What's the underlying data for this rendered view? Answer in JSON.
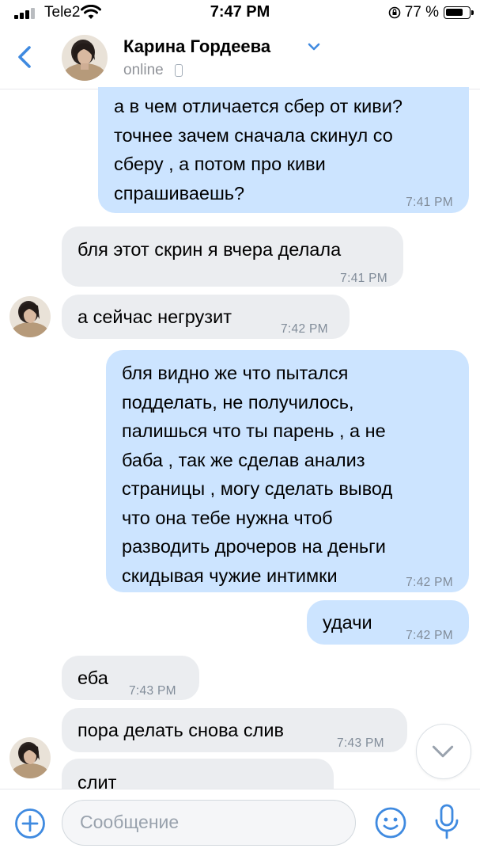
{
  "status_bar": {
    "carrier": "Tele2",
    "time": "7:47 PM",
    "battery": "77 %",
    "battery_level": 0.77
  },
  "header": {
    "contact_name": "Карина Гордеева",
    "status": "online"
  },
  "messages": [
    {
      "dir": "out",
      "text": "а в чем отличается сбер от киви?\nточнее зачем сначала скинул со\nсберу , а потом про киви\nспрашиваешь?",
      "time": "7:41 PM"
    },
    {
      "dir": "in",
      "text": "бля этот скрин я вчера делала",
      "time": "7:41 PM"
    },
    {
      "dir": "in",
      "text": "а сейчас негрузит",
      "time": "7:42 PM"
    },
    {
      "dir": "out",
      "text": "бля видно же что пытался\nподделать, не получилось,\nпалишься что ты парень , а не\nбаба , так же сделав анализ\nстраницы , могу сделать вывод\nчто она тебе нужна чтоб\nразводить дрочеров на деньги\nскидывая чужие интимки",
      "time": "7:42 PM"
    },
    {
      "dir": "out",
      "text": "удачи",
      "time": "7:42 PM"
    },
    {
      "dir": "in",
      "text": "еба",
      "time": "7:43 PM"
    },
    {
      "dir": "in",
      "text": "пора делать снова слив",
      "time": "7:43 PM"
    },
    {
      "dir": "in",
      "text": "слит",
      "time": ""
    }
  ],
  "composer": {
    "placeholder": "Сообщение"
  },
  "colors": {
    "accent": "#3f8ae0",
    "outgoing_bubble": "#cce4ff",
    "incoming_bubble": "#ebedf0",
    "timestamp": "#818c99"
  },
  "icons": [
    "back-icon",
    "chevron-down-icon",
    "mobile-icon",
    "scroll-down-icon",
    "plus-icon",
    "smile-icon",
    "microphone-icon"
  ]
}
